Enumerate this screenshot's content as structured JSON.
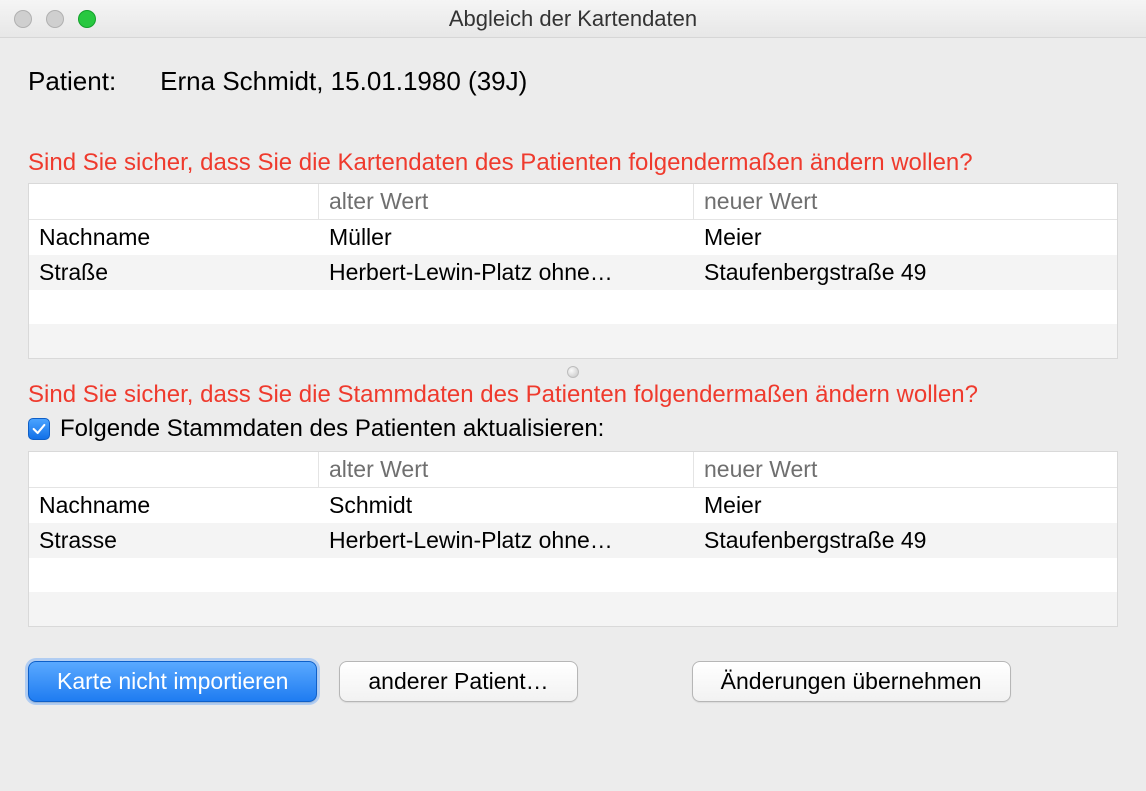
{
  "window": {
    "title": "Abgleich der Kartendaten"
  },
  "patient": {
    "label": "Patient:",
    "value": "Erna Schmidt, 15.01.1980 (39J)"
  },
  "section1": {
    "heading": "Sind Sie sicher, dass Sie die Kartendaten des Patienten folgendermaßen ändern wollen?",
    "headers": {
      "col1": "",
      "col2": "alter Wert",
      "col3": "neuer Wert"
    },
    "rows": [
      {
        "field": "Nachname",
        "old": "Müller",
        "new": "Meier"
      },
      {
        "field": "Straße",
        "old": "Herbert-Lewin-Platz ohne…",
        "new": "Staufenbergstraße 49"
      }
    ]
  },
  "section2": {
    "heading": "Sind Sie sicher, dass Sie die Stammdaten des Patienten folgendermaßen ändern wollen?",
    "checkbox_label": "Folgende Stammdaten des Patienten aktualisieren:",
    "headers": {
      "col1": "",
      "col2": "alter Wert",
      "col3": "neuer Wert"
    },
    "rows": [
      {
        "field": "Nachname",
        "old": "Schmidt",
        "new": "Meier"
      },
      {
        "field": "Strasse",
        "old": "Herbert-Lewin-Platz ohne…",
        "new": "Staufenbergstraße 49"
      }
    ]
  },
  "buttons": {
    "no_import": "Karte nicht importieren",
    "other_patient": "anderer Patient…",
    "apply": "Änderungen übernehmen"
  }
}
